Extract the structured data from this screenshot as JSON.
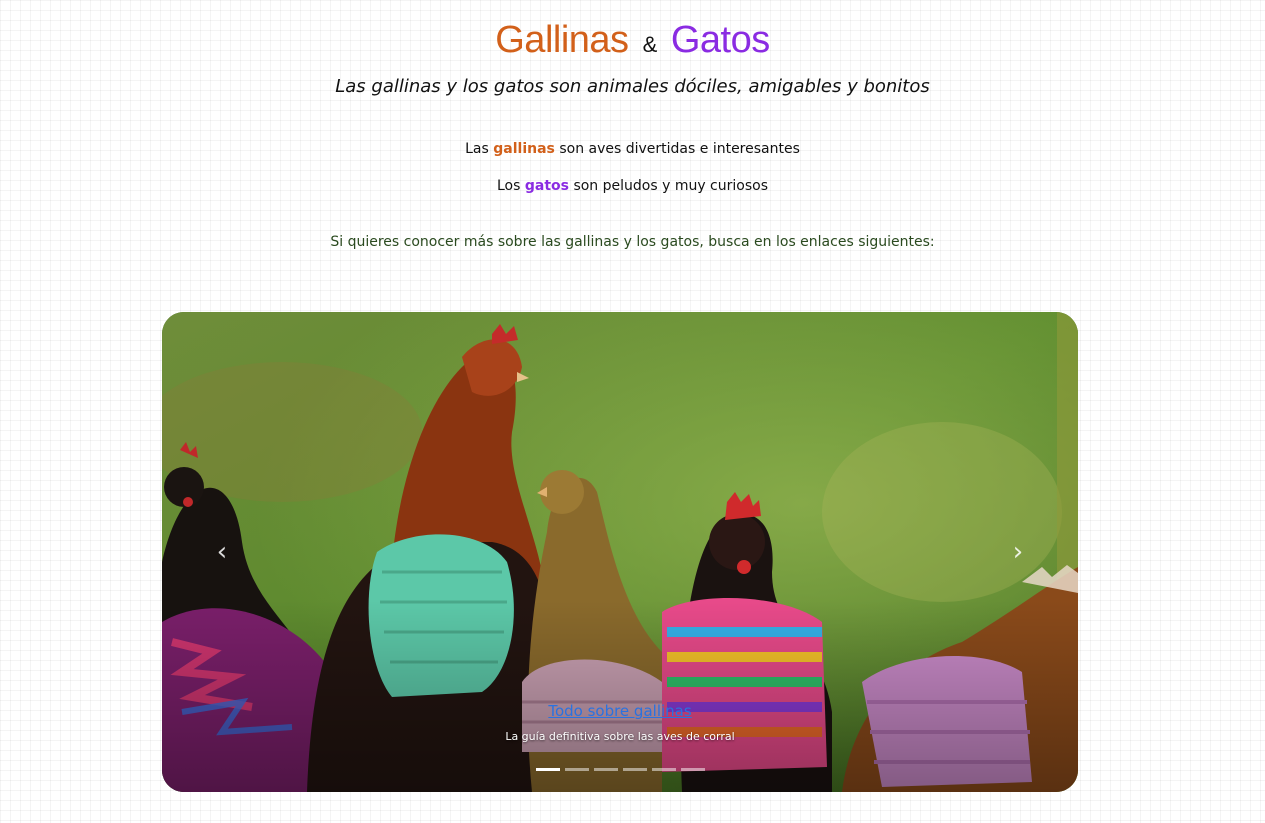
{
  "header": {
    "title_part1": "Gallinas",
    "title_amp": "&",
    "title_part2": "Gatos",
    "subtitle": "Las gallinas y los gatos son animales dóciles, amigables y bonitos"
  },
  "facts": {
    "line1_prefix": "Las",
    "line1_highlight": "gallinas",
    "line1_suffix": "son aves divertidas e interesantes",
    "line2_prefix": "Los",
    "line2_highlight": "gatos",
    "line2_suffix": "son peludos y muy curiosos"
  },
  "prompt": "Si quieres conocer más sobre las gallinas y los gatos, busca en los enlaces siguientes:",
  "carousel": {
    "slide_link": "Todo sobre gallinas",
    "slide_caption": "La guía definitiva sobre las aves de corral",
    "prev_icon": "chevron-left-icon",
    "next_icon": "chevron-right-icon",
    "slide_count": 6,
    "active_slide": 1
  },
  "colors": {
    "gallinas": "#d2601a",
    "gatos": "#8a2be2",
    "prompt": "#2a4a1f",
    "link": "#2a72e0"
  }
}
